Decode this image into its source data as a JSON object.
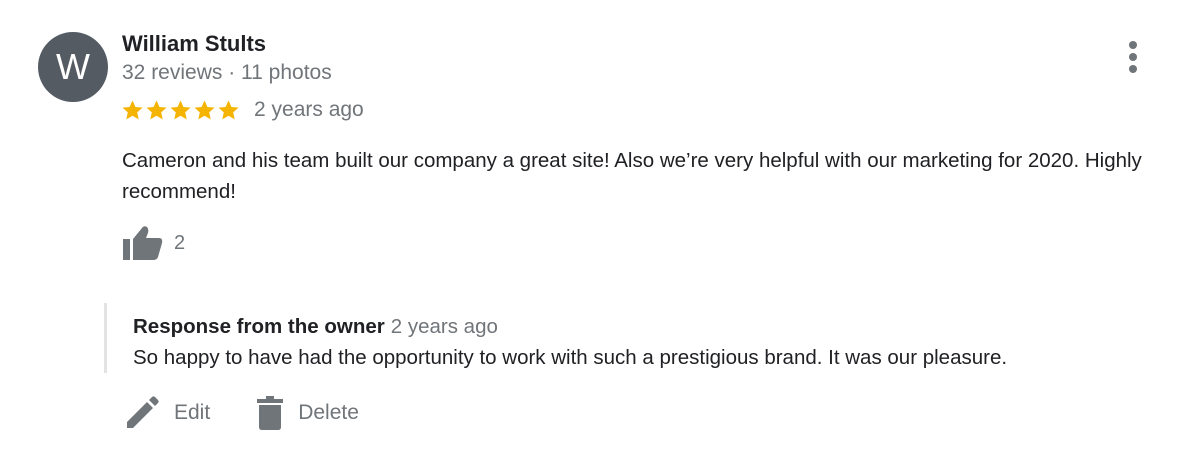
{
  "reviewer": {
    "initial": "W",
    "name": "William Stults",
    "meta": "32 reviews · 11 photos",
    "avatar_color": "#545b63"
  },
  "review": {
    "rating": 5,
    "rating_max": 5,
    "star_color": "#f4b400",
    "time": "2 years ago",
    "text": "Cameron and his team built our company a great site! Also we’re very helpful with our marketing for 2020. Highly recommend!",
    "likes": "2"
  },
  "owner_response": {
    "label": "Response from the owner",
    "time": "2 years ago",
    "text": "So happy to have had the opportunity to work with such a prestigious brand. It was our pleasure."
  },
  "actions": {
    "edit_label": "Edit",
    "delete_label": "Delete"
  },
  "icons": {
    "more": "more-vert-icon",
    "star": "star-icon",
    "like": "thumbs-up-icon",
    "edit": "pencil-icon",
    "delete": "trash-icon"
  },
  "colors": {
    "text_primary": "#202124",
    "text_secondary": "#70757a",
    "icon_gray": "#70757a",
    "response_border": "#e3e3e3"
  }
}
